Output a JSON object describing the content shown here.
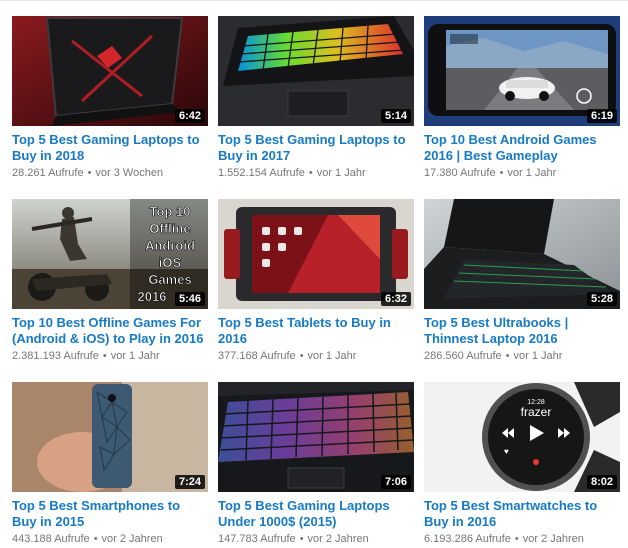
{
  "videos": [
    {
      "title": "Top 5 Best Gaming Laptops to Buy in 2018",
      "duration": "6:42",
      "views": "28.261 Aufrufe",
      "age": "vor 3 Wochen",
      "thumb_icon": "red-black-gaming-laptop-thumbnail"
    },
    {
      "title": "Top 5 Best Gaming Laptops to Buy in 2017",
      "duration": "5:14",
      "views": "1.552.154 Aufrufe",
      "age": "vor 1 Jahr",
      "thumb_icon": "rgb-keyboard-laptop-thumbnail"
    },
    {
      "title": "Top 10 Best Android Games 2016 | Best Gameplay",
      "duration": "6:19",
      "views": "17.380 Aufrufe",
      "age": "vor 1 Jahr",
      "thumb_icon": "racing-game-phone-thumbnail"
    },
    {
      "title": "Top 10 Best Offline Games For (Android & iOS) to Play in 2016",
      "duration": "5:46",
      "views": "2.381.193 Aufrufe",
      "age": "vor 1 Jahr",
      "thumb_icon": "offline-games-poster-thumbnail",
      "thumb_text": [
        "Top 10",
        "Offline",
        "Android",
        "iOS",
        "Games",
        "2016"
      ]
    },
    {
      "title": "Top 5 Best Tablets to Buy in 2016",
      "duration": "6:32",
      "views": "377.168 Aufrufe",
      "age": "vor 1 Jahr",
      "thumb_icon": "tablet-homescreen-thumbnail"
    },
    {
      "title": "Top 5 Best Ultrabooks | Thinnest Laptop 2016",
      "duration": "5:28",
      "views": "286.560 Aufrufe",
      "age": "vor 1 Jahr",
      "thumb_icon": "ultrabook-keyboard-thumbnail"
    },
    {
      "title": "Top 5 Best Smartphones to Buy in 2015",
      "duration": "7:24",
      "views": "443.188 Aufrufe",
      "age": "vor 2 Jahren",
      "thumb_icon": "smartphone-in-hand-thumbnail"
    },
    {
      "title": "Top 5 Best Gaming Laptops Under 1000$ (2015)",
      "duration": "7:06",
      "views": "147.783 Aufrufe",
      "age": "vor 2 Jahren",
      "thumb_icon": "backlit-keyboard-thumbnail"
    },
    {
      "title": "Top 5 Best Smartwatches to Buy in 2016",
      "duration": "8:02",
      "views": "6.193.286 Aufrufe",
      "age": "vor 2 Jahren",
      "thumb_icon": "round-smartwatch-thumbnail",
      "thumb_text": [
        "frazer",
        "12:28"
      ]
    }
  ]
}
